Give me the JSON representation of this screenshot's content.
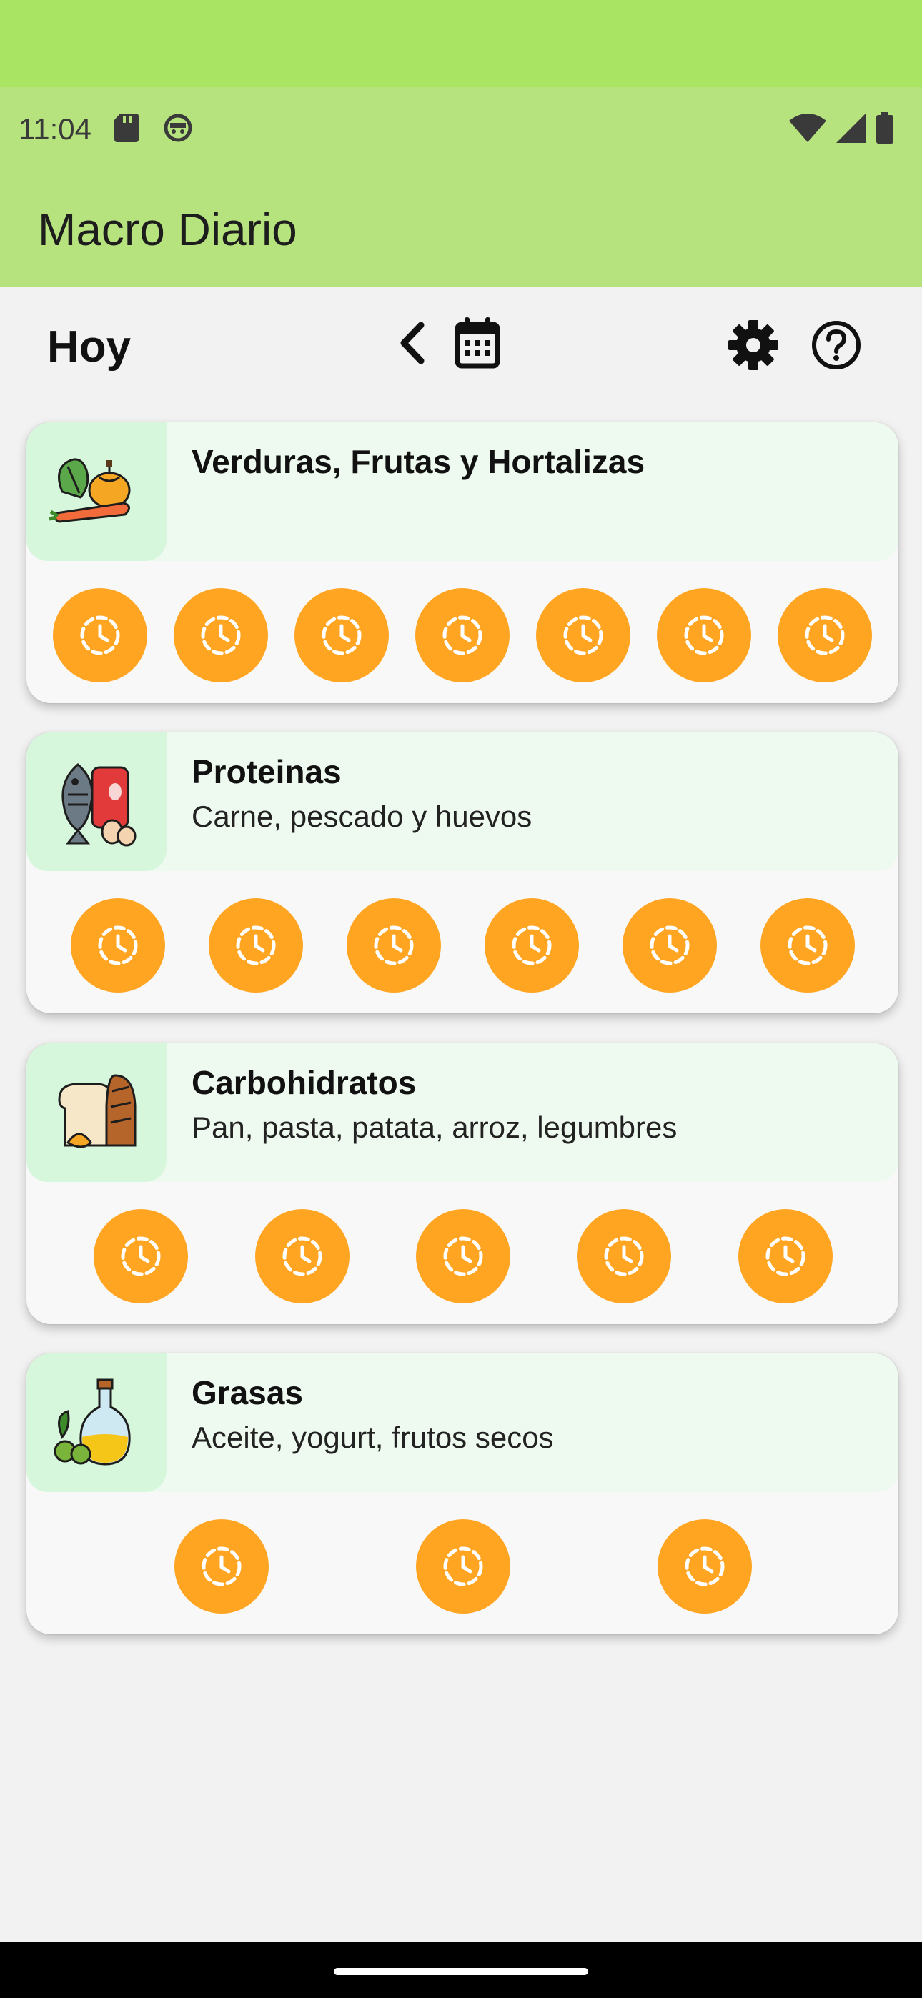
{
  "status_bar": {
    "time": "11:04"
  },
  "app_bar": {
    "title": "Macro Diario"
  },
  "toolbar": {
    "today_label": "Hoy"
  },
  "colors": {
    "app_bar_green": "#b7e37e",
    "slot_orange": "#ffa522",
    "header_tint": "#eef9ef",
    "thumb_tint": "#d7f7dc"
  },
  "groups": [
    {
      "title": "Verduras, Frutas y Hortalizas",
      "subtitle": "",
      "icon": "vegetables-icon",
      "slot_count": 7
    },
    {
      "title": "Proteinas",
      "subtitle": "Carne, pescado y huevos",
      "icon": "protein-icon",
      "slot_count": 6
    },
    {
      "title": "Carbohidratos",
      "subtitle": "Pan, pasta, patata, arroz, legumbres",
      "icon": "carbs-icon",
      "slot_count": 5
    },
    {
      "title": "Grasas",
      "subtitle": "Aceite, yogurt, frutos secos",
      "icon": "fats-icon",
      "slot_count": 3
    }
  ]
}
